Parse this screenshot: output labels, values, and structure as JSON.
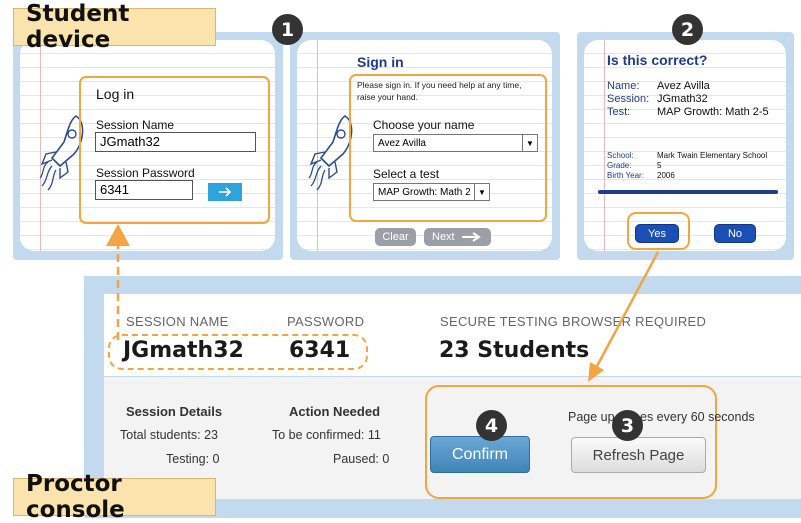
{
  "labels": {
    "student_device": "Student device",
    "proctor_console": "Proctor console"
  },
  "steps": [
    "1",
    "2",
    "3",
    "4"
  ],
  "login": {
    "title": "Log in",
    "session_name_label": "Session Name",
    "session_name_value": "JGmath32",
    "password_label": "Session Password",
    "password_value": "6341",
    "go_icon": "arrow-right-icon"
  },
  "signin": {
    "title": "Sign in",
    "help_text": "Please sign in. If you need help at any time, raise your hand.",
    "name_label": "Choose your name",
    "name_value": "Avez Avilla",
    "test_label": "Select a test",
    "test_value": "MAP Growth: Math 2",
    "clear": "Clear",
    "next": "Next"
  },
  "confirm": {
    "title": "Is this correct?",
    "rows": [
      {
        "k": "Name:",
        "v": "Avez Avilla"
      },
      {
        "k": "Session:",
        "v": "JGmath32"
      },
      {
        "k": "Test:",
        "v": "MAP Growth: Math 2-5"
      }
    ],
    "small_rows": [
      {
        "k": "School:",
        "v": "Mark Twain Elementary School"
      },
      {
        "k": "Grade:",
        "v": "5"
      },
      {
        "k": "Birth Year:",
        "v": "2006"
      }
    ],
    "yes": "Yes",
    "no": "No"
  },
  "console": {
    "session_name_head": "SESSION NAME",
    "password_head": "PASSWORD",
    "secure_head": "SECURE TESTING BROWSER REQUIRED",
    "session_name": "JGmath32",
    "password": "6341",
    "students": "23 Students",
    "details_head": "Session Details",
    "total": "Total students: 23",
    "testing": "Testing: 0",
    "action_head": "Action Needed",
    "to_confirm": "To be confirmed: 11",
    "paused": "Paused: 0",
    "confirm_btn": "Confirm",
    "refresh_btn": "Refresh Page",
    "update_a": "Page up",
    "update_b": "es every 60 seconds"
  },
  "colors": {
    "accent_orange": "#f2a540",
    "frame_blue": "#c3d9ee",
    "confirm_blue": "#4a8fbf"
  }
}
